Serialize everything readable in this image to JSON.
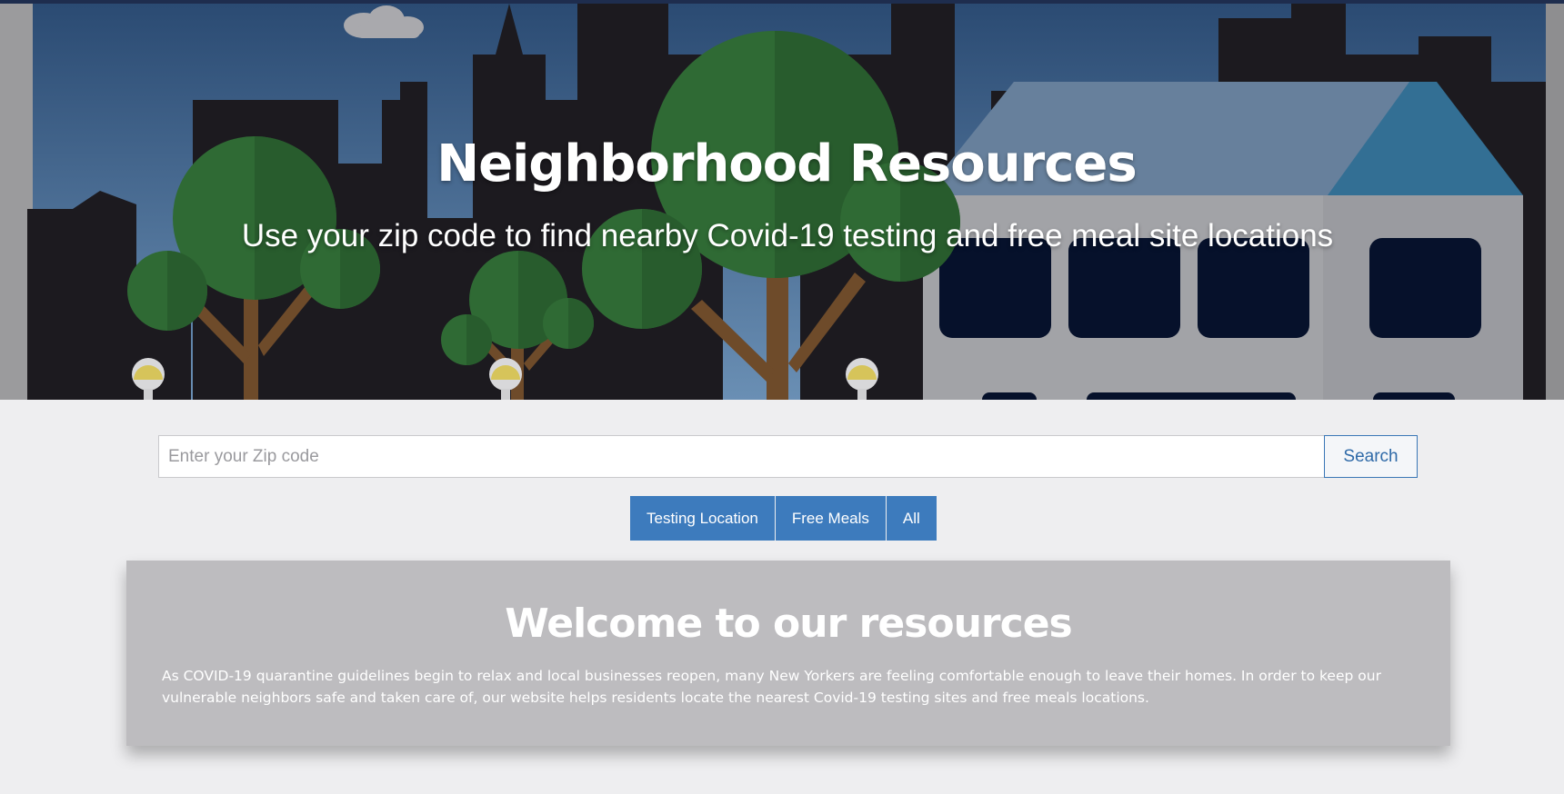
{
  "hero": {
    "title": "Neighborhood Resources",
    "subtitle": "Use your zip code to find nearby Covid-19 testing and free meal site locations"
  },
  "search": {
    "placeholder": "Enter your Zip code",
    "value": "",
    "button_label": "Search"
  },
  "filters": [
    {
      "label": "Testing Location"
    },
    {
      "label": "Free Meals"
    },
    {
      "label": "All"
    }
  ],
  "welcome": {
    "title": "Welcome to our resources",
    "text": "As COVID-19 quarantine guidelines begin to relax and local businesses reopen, many New Yorkers are feeling comfortable enough to leave their homes. In order to keep our vulnerable neighbors safe and taken care of, our website helps residents locate the nearest Covid-19 testing sites and free meals locations."
  },
  "colors": {
    "accent": "#3d7bbd",
    "sky_top": "#2a4a72",
    "sky_bottom": "#5f86ad",
    "tree": "#2f6a34",
    "card": "#bdbcbf",
    "page_bg": "#eeeef0"
  }
}
